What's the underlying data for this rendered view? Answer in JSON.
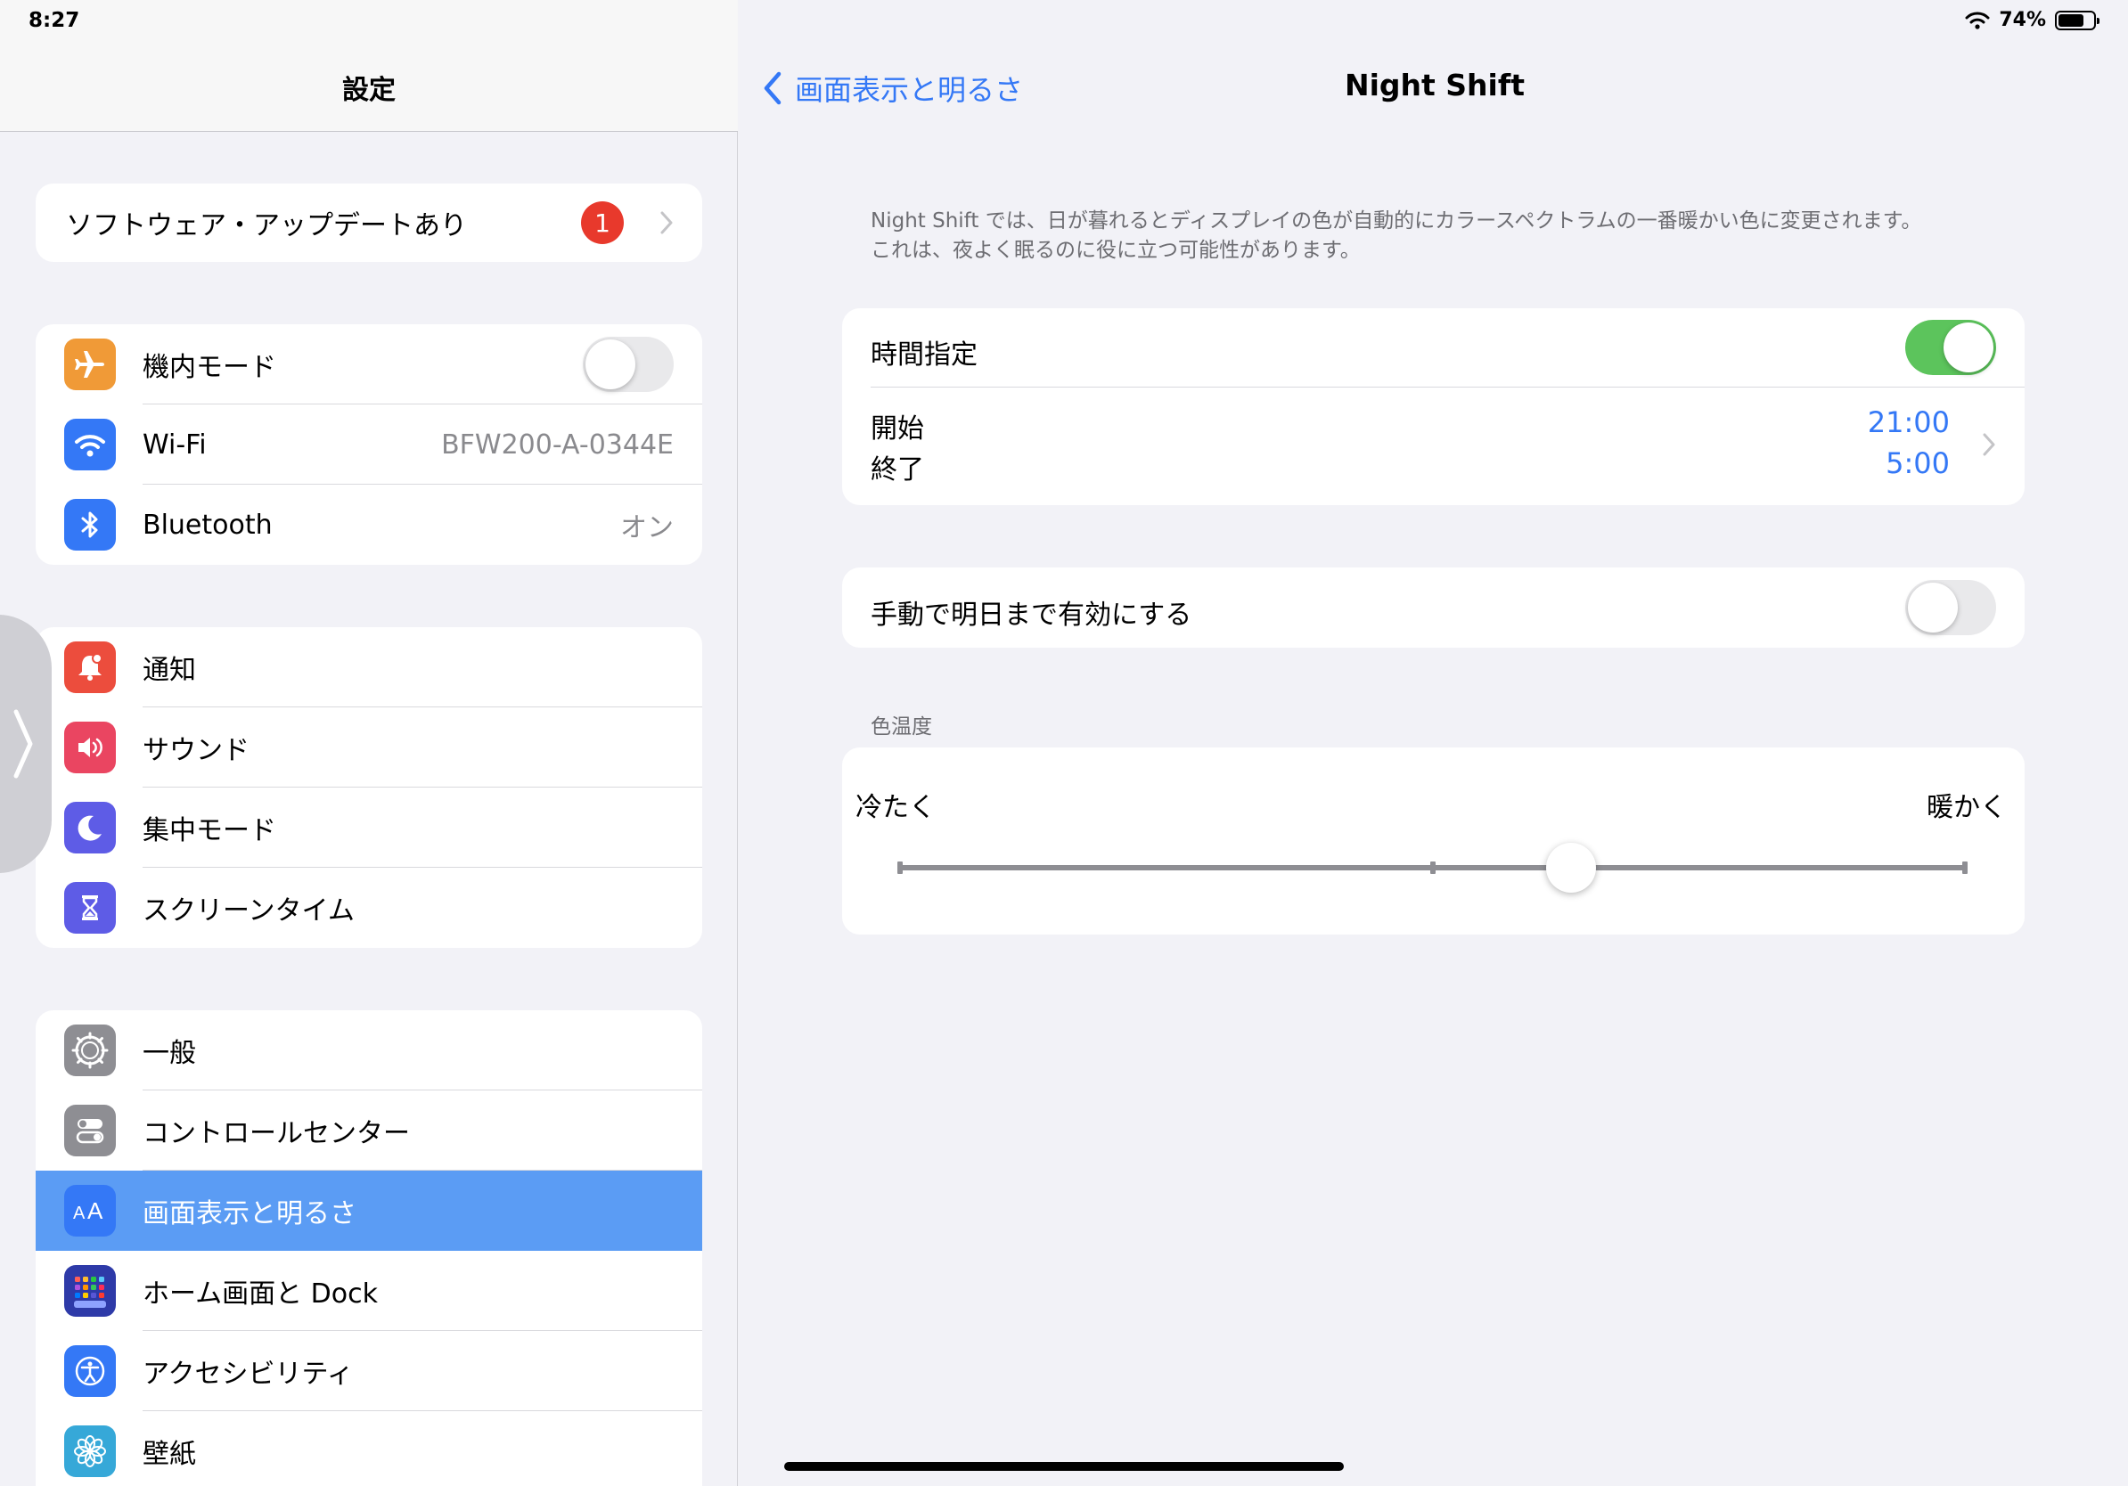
{
  "status_bar": {
    "time": "8:27",
    "battery_percent": "74%",
    "battery_level": 0.74
  },
  "sidebar": {
    "title": "設定",
    "update_banner": {
      "label": "ソフトウェア・アップデートあり",
      "badge": "1"
    },
    "connectivity": [
      {
        "label": "機内モード",
        "icon": "airplane-icon",
        "color": "#f09a37",
        "toggle": false
      },
      {
        "label": "Wi-Fi",
        "icon": "wifi-icon",
        "color": "#3478f6",
        "value": "BFW200-A-0344E"
      },
      {
        "label": "Bluetooth",
        "icon": "bluetooth-icon",
        "color": "#3478f6",
        "value": "オン"
      }
    ],
    "notifications": [
      {
        "label": "通知",
        "icon": "bell-icon",
        "color": "#ec4d3d"
      },
      {
        "label": "サウンド",
        "icon": "speaker-icon",
        "color": "#ea4561"
      },
      {
        "label": "集中モード",
        "icon": "moon-icon",
        "color": "#5e5ce6"
      },
      {
        "label": "スクリーンタイム",
        "icon": "hourglass-icon",
        "color": "#5e5ce6"
      }
    ],
    "general": [
      {
        "label": "一般",
        "icon": "gear-icon",
        "color": "#8e8e93"
      },
      {
        "label": "コントロールセンター",
        "icon": "switches-icon",
        "color": "#8e8e93"
      },
      {
        "label": "画面表示と明るさ",
        "icon": "text-size-icon",
        "color": "#3478f6",
        "selected": true
      },
      {
        "label": "ホーム画面と Dock",
        "icon": "home-grid-icon",
        "color": "#2e3aa8"
      },
      {
        "label": "アクセシビリティ",
        "icon": "accessibility-icon",
        "color": "#3478f6"
      },
      {
        "label": "壁紙",
        "icon": "flower-icon",
        "color": "#36a8d8"
      }
    ]
  },
  "detail": {
    "back_label": "画面表示と明るさ",
    "title": "Night Shift",
    "description_line1": "Night Shift では、日が暮れるとディスプレイの色が自動的にカラースペクトラムの一番暖かい色に変更されます。",
    "description_line2": "これは、夜よく眠るのに役に立つ可能性があります。",
    "schedule": {
      "label": "時間指定",
      "enabled": true,
      "from_label": "開始",
      "to_label": "終了",
      "from_time": "21:00",
      "to_time": "5:00"
    },
    "manual": {
      "label": "手動で明日まで有効にする",
      "enabled": false
    },
    "temperature": {
      "section_label": "色温度",
      "cooler_label": "冷たく",
      "warmer_label": "暖かく",
      "value": 0.63
    }
  },
  "colors": {
    "accent": "#3478f6",
    "toggle_on": "#5cc45c",
    "selected_row": "#5b9cf4",
    "badge": "#e8392c"
  }
}
